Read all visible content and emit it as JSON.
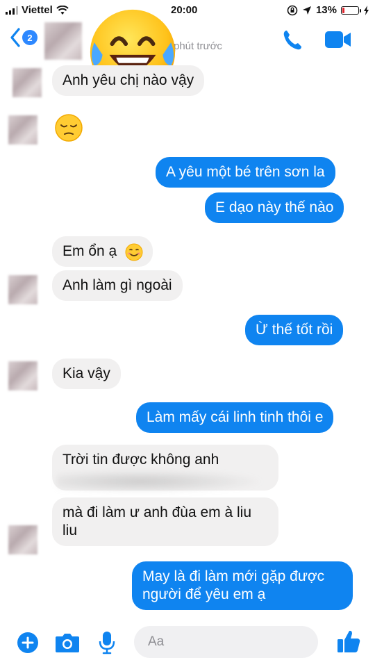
{
  "status_bar": {
    "carrier": "Viettel",
    "time": "20:00",
    "battery_percent": "13%",
    "battery_level": 0.13
  },
  "header": {
    "back_badge": "2",
    "subtitle": "phút trước",
    "accent": "#0f84f0"
  },
  "messages": [
    {
      "side": "in",
      "text": "Anh yêu chị nào vậy"
    },
    {
      "side": "in",
      "emoji": "pensive-face"
    },
    {
      "side": "out",
      "text": "A yêu một bé trên sơn la"
    },
    {
      "side": "out",
      "text": "E dạo này thế nào"
    },
    {
      "side": "in",
      "text": "Em ổn ạ"
    },
    {
      "side": "in",
      "text": "Anh làm gì ngoài"
    },
    {
      "side": "out",
      "text": "Ừ thế tốt rồi"
    },
    {
      "side": "in",
      "text": "Kia vậy"
    },
    {
      "side": "out",
      "text": "Làm mấy cái linh tinh thôi e"
    },
    {
      "side": "in",
      "text": "Trời tin được không anh"
    },
    {
      "side": "in",
      "text": "mà đi làm ư anh đùa em à liu liu"
    },
    {
      "side": "out",
      "text": "May là đi làm mới gặp được người để yêu em ạ"
    }
  ],
  "composer": {
    "placeholder": "Aa"
  }
}
